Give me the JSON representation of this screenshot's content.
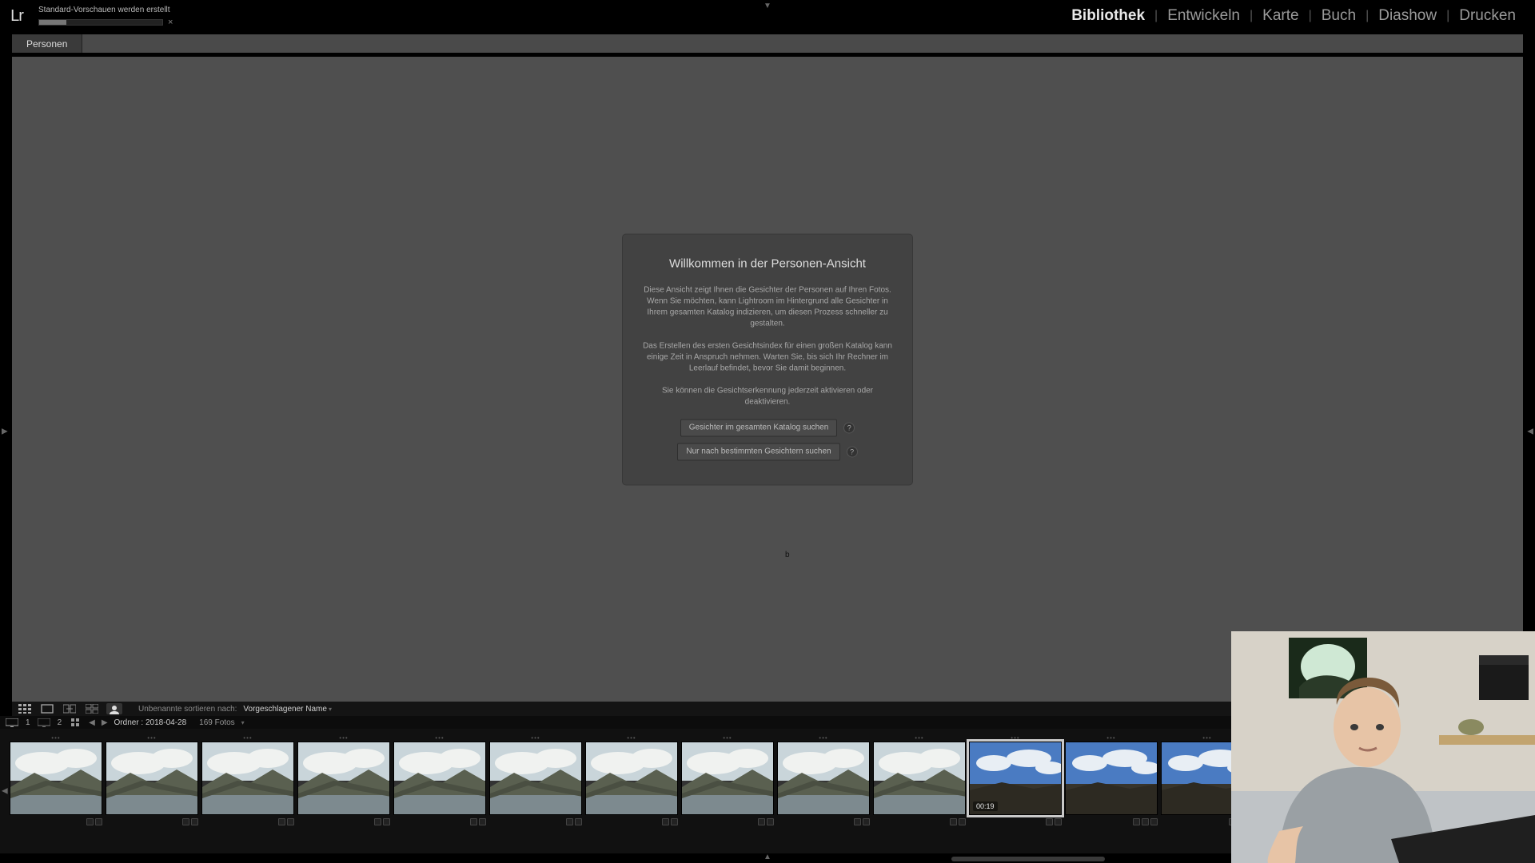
{
  "logo": "Lr",
  "progress": {
    "label": "Standard-Vorschauen werden erstellt",
    "close": "×"
  },
  "modules": [
    "Bibliothek",
    "Entwickeln",
    "Karte",
    "Buch",
    "Diashow",
    "Drucken"
  ],
  "module_sep": "|",
  "active_module": 0,
  "subtabs": [
    "Personen"
  ],
  "welcome": {
    "title": "Willkommen in der Personen-Ansicht",
    "p1": "Diese Ansicht zeigt Ihnen die Gesichter der Personen auf Ihren Fotos. Wenn Sie möchten, kann Lightroom im Hintergrund alle Gesichter in Ihrem gesamten Katalog indizieren, um diesen Prozess schneller zu gestalten.",
    "p2": "Das Erstellen des ersten Gesichtsindex für einen großen Katalog kann einige Zeit in Anspruch nehmen. Warten Sie, bis sich Ihr Rechner im Leerlauf befindet, bevor Sie damit beginnen.",
    "p3": "Sie können die Gesichtserkennung jederzeit aktivieren oder deaktivieren.",
    "btn1": "Gesichter im gesamten Katalog suchen",
    "btn2": "Nur nach bestimmten Gesichtern suchen",
    "info": "?"
  },
  "cursor_char": "b",
  "toolbar": {
    "sort_label": "Unbenannte sortieren nach:",
    "sort_value": "Vorgeschlagener Name"
  },
  "fs_head": {
    "monitor1": "1",
    "monitor2": "2",
    "path": "Ordner : 2018-04-28",
    "count": "169 Fotos"
  },
  "thumbnail_badge_video": "00:19",
  "thumbnails": {
    "count": 16,
    "selected": 10,
    "video": 10,
    "dark_start": 11
  }
}
